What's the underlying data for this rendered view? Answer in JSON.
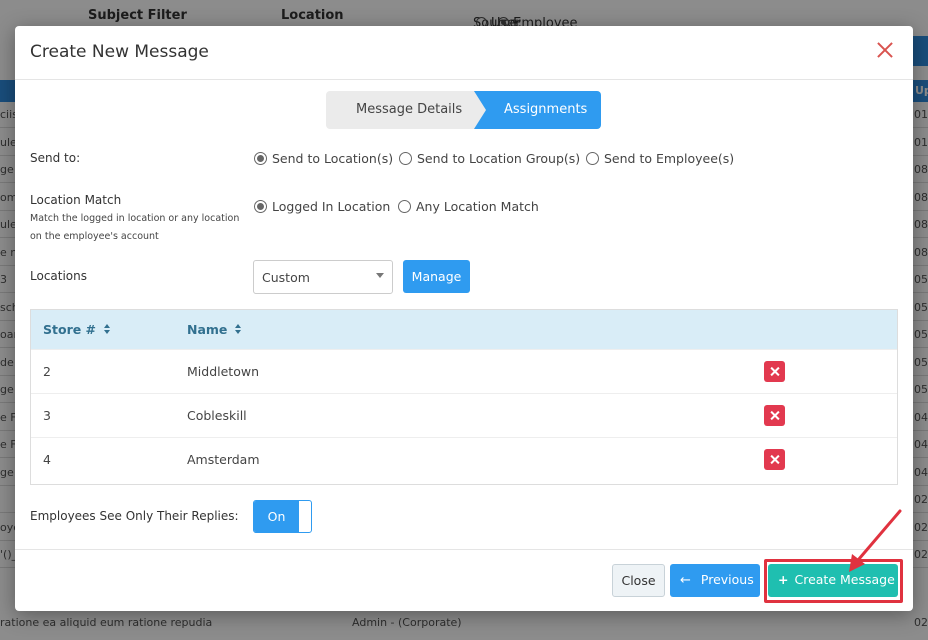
{
  "background": {
    "subject_filter": "Subject Filter",
    "location": "Location",
    "source_label": "Source:",
    "source_user": "User",
    "source_employee": "Employee",
    "header_right": "Up",
    "left_rows": [
      "ciis",
      "ule",
      "ge",
      "om",
      "ule",
      "e n",
      "3",
      "sch",
      "oar",
      "de",
      "ge",
      "e F",
      "e F",
      "ge",
      "",
      "oye",
      "'()_"
    ],
    "right_rows": [
      "01",
      "01",
      "08",
      "08",
      "08",
      "08",
      "05",
      "05",
      "05",
      "05",
      "05",
      "04",
      "04",
      "04",
      "02",
      "02",
      "02"
    ],
    "bottom_left": "ratione ea aliquid eum ratione repudia",
    "bottom_mid": "Admin - (Corporate)",
    "bottom_right": "02"
  },
  "modal": {
    "title": "Create New Message",
    "steps": [
      "Message Details",
      "Assignments"
    ],
    "send_to_label": "Send to:",
    "send_to_options": [
      "Send to Location(s)",
      "Send to Location Group(s)",
      "Send to Employee(s)"
    ],
    "location_match_label": "Location Match",
    "location_match_help": "Match the logged in location or any location on the employee's account",
    "location_match_options": [
      "Logged In Location",
      "Any Location Match"
    ],
    "locations_label": "Locations",
    "locations_select_value": "Custom",
    "manage_label": "Manage",
    "table": {
      "headers": [
        "Store #",
        "Name"
      ],
      "rows": [
        {
          "store": "2",
          "name": "Middletown"
        },
        {
          "store": "3",
          "name": "Cobleskill"
        },
        {
          "store": "4",
          "name": "Amsterdam"
        }
      ]
    },
    "replies_label": "Employees See Only Their Replies:",
    "toggle_value": "On",
    "close_label": "Close",
    "previous_label": "Previous",
    "create_label": "Create Message"
  },
  "colors": {
    "primary": "#2f9bf0",
    "create": "#1fbfb0",
    "danger": "#e2394f",
    "highlight": "#e0323f",
    "table_header_bg": "#d9edf7"
  }
}
